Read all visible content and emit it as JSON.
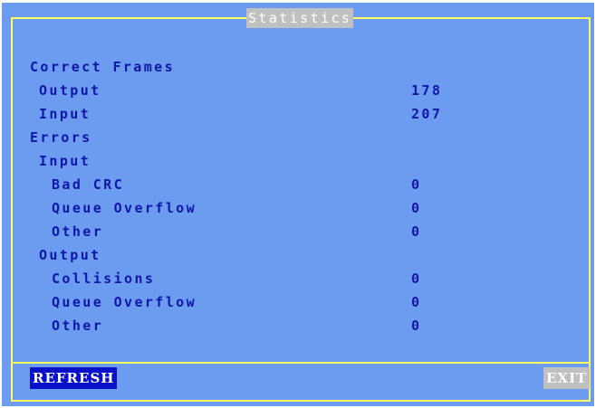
{
  "window": {
    "title": "Statistics"
  },
  "correct_frames": {
    "heading": "Correct Frames",
    "output_label": "Output",
    "output_value": "178",
    "input_label": "Input",
    "input_value": "207"
  },
  "errors": {
    "heading": "Errors",
    "input": {
      "heading": "Input",
      "bad_crc_label": "Bad CRC",
      "bad_crc_value": "0",
      "queue_overflow_label": "Queue Overflow",
      "queue_overflow_value": "0",
      "other_label": "Other",
      "other_value": "0"
    },
    "output": {
      "heading": "Output",
      "collisions_label": "Collisions",
      "collisions_value": "0",
      "queue_overflow_label": "Queue Overflow",
      "queue_overflow_value": "0",
      "other_label": "Other",
      "other_value": "0"
    }
  },
  "buttons": {
    "refresh_label": "REFRESH",
    "exit_label": "EXIT"
  },
  "colors": {
    "background": "#6b9cf0",
    "border": "#ffff60",
    "text": "#1016a8",
    "refresh_bg": "#0a10c8",
    "title_bg": "#c0c0c0"
  }
}
